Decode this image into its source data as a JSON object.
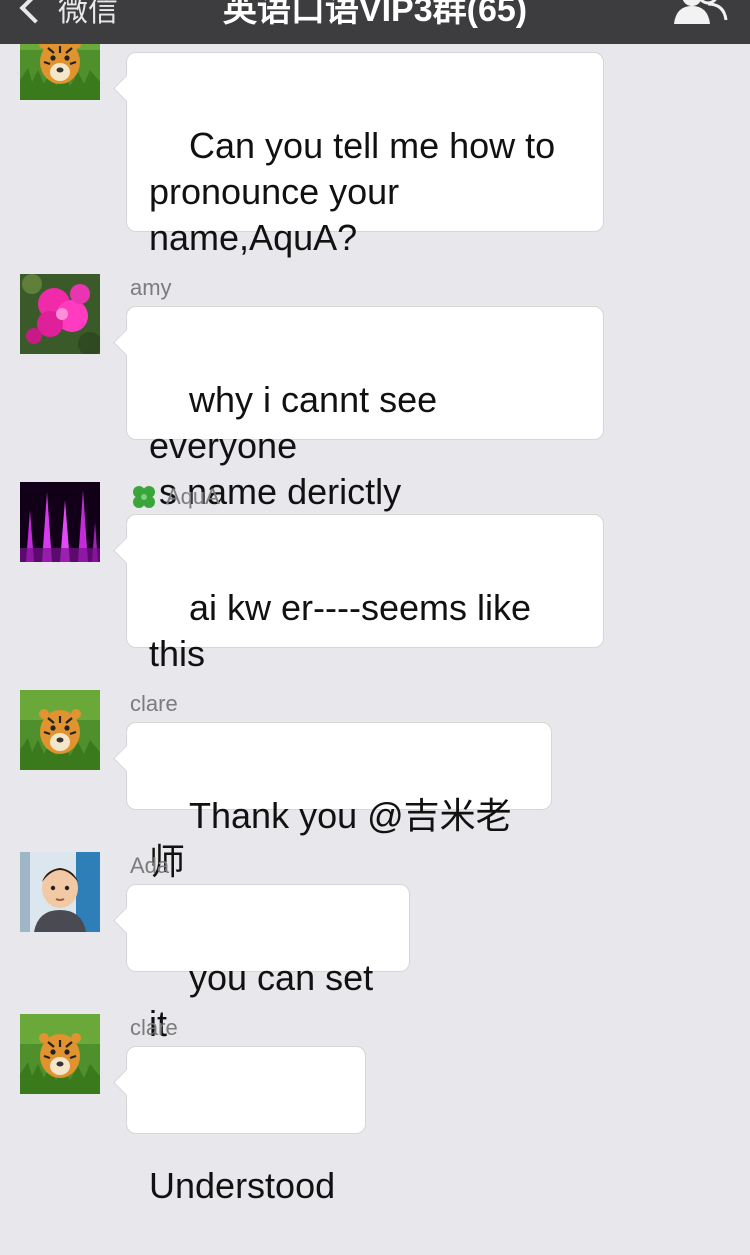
{
  "navbar": {
    "back_label": "微信",
    "title": "英语口语VIP3群(65)"
  },
  "messages": [
    {
      "sender": "",
      "avatar": "tiger-avatar",
      "text": "Can you tell me how to\npronounce your\nname,AquA?"
    },
    {
      "sender": "amy",
      "avatar": "pink-flower-avatar",
      "text": "why i cannt see everyone\n s name derictly"
    },
    {
      "sender": "AquA",
      "sender_icon": "clover-icon",
      "avatar": "purple-light-avatar",
      "text": "ai kw er----seems like\nthis"
    },
    {
      "sender": "clare",
      "avatar": "tiger-avatar",
      "text": "Thank you @吉米老师"
    },
    {
      "sender": "Ada",
      "avatar": "child-photo-avatar",
      "text": "you can set it"
    },
    {
      "sender": "clare",
      "avatar": "tiger-avatar",
      "text": "Understood"
    }
  ],
  "colors": {
    "navbar_bg": "#3d3d3f",
    "chat_bg": "#e8e8ec",
    "bubble_bg": "#ffffff",
    "sender_name": "#7c7c7c"
  }
}
